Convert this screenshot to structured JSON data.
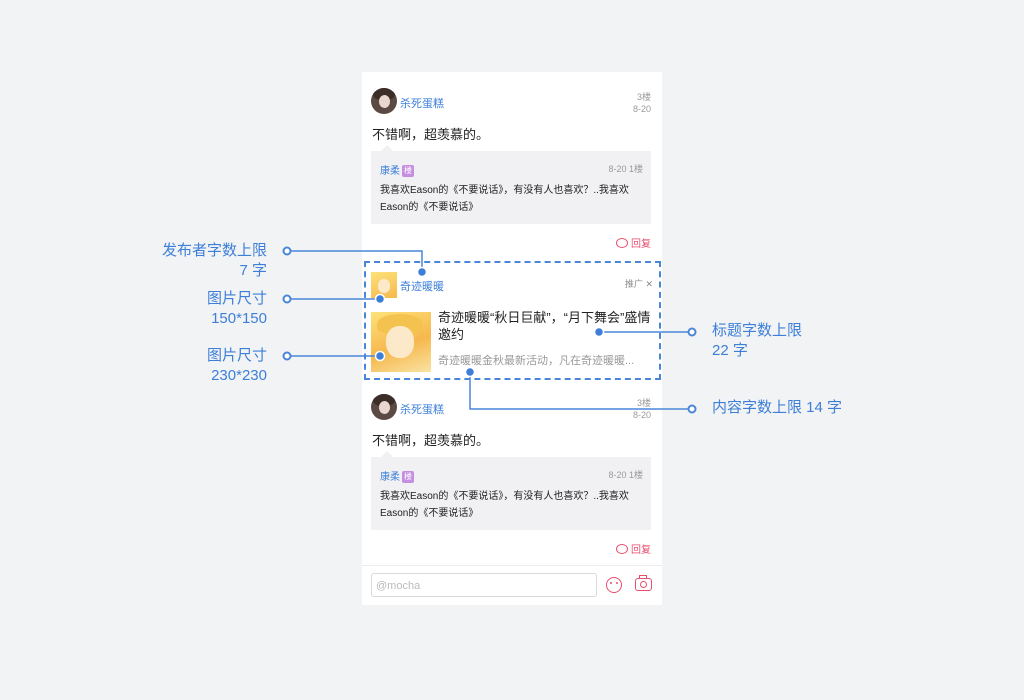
{
  "post1": {
    "username": "杀死蛋糕",
    "floor": "3楼",
    "date": "8-20",
    "text": "不错啊，超羡慕的。",
    "quote": {
      "name": "康柔",
      "badge": "楼",
      "meta": "8-20  1楼",
      "body": "我喜欢Eason的《不要说话》，有没有人也喜欢？..我喜欢Eason的《不要说话》"
    },
    "reply": "回复"
  },
  "ad": {
    "username": "奇迹暖暖",
    "tag": "推广",
    "close": "✕",
    "title": "奇迹暖暖“秋日巨献”，“月下舞会”盛情邀约",
    "subtitle": "奇迹暖暖金秋最新活动，凡在奇迹暖暖..."
  },
  "post2": {
    "username": "杀死蛋糕",
    "floor": "3楼",
    "date": "8-20",
    "text": "不错啊，超羡慕的。",
    "quote": {
      "name": "康柔",
      "badge": "楼",
      "meta": "8-20  1楼",
      "body": "我喜欢Eason的《不要说话》，有没有人也喜欢？..我喜欢Eason的《不要说话》"
    },
    "reply": "回复"
  },
  "input": {
    "placeholder": "@mocha"
  },
  "annotations": {
    "publisher_limit_1": "发布者字数上限",
    "publisher_limit_2": "7 字",
    "small_img_1": "图片尺寸",
    "small_img_2": "150*150",
    "big_img_1": "图片尺寸",
    "big_img_2": "230*230",
    "title_limit_1": "标题字数上限",
    "title_limit_2": "22 字",
    "content_limit": "内容字数上限 14 字"
  },
  "colors": {
    "accent": "#3d7fd8",
    "reply": "#e94d6c",
    "badge": "#c58ee0"
  }
}
